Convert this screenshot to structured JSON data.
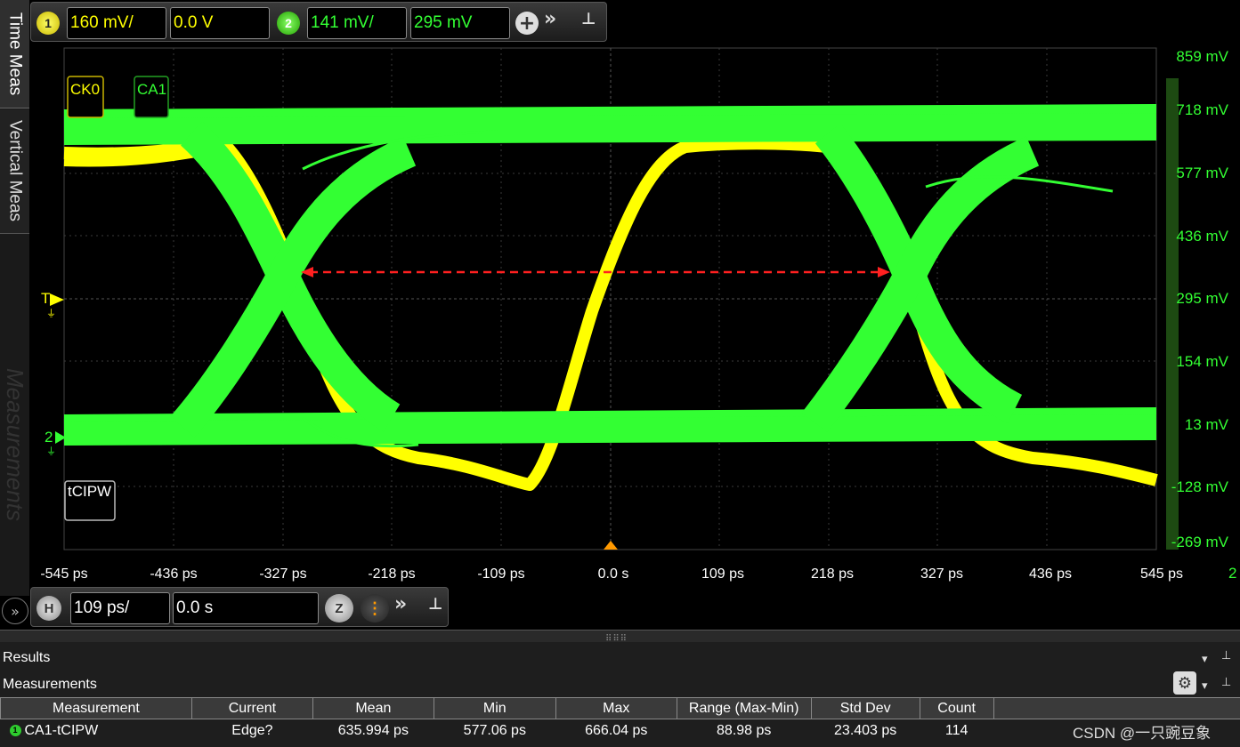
{
  "channels": {
    "ch1": {
      "number": "1",
      "scale": "160 mV/",
      "offset": "0.0 V",
      "color": "#ffff00"
    },
    "ch2": {
      "number": "2",
      "scale": "141 mV/",
      "offset": "295 mV",
      "color": "#33ff33"
    }
  },
  "side_tabs": [
    "Time Meas",
    "Vertical Meas",
    "Measurements"
  ],
  "plot": {
    "x_ticks": [
      "-545 ps",
      "-436 ps",
      "-327 ps",
      "-218 ps",
      "-109 ps",
      "0.0 s",
      "109 ps",
      "218 ps",
      "327 ps",
      "436 ps",
      "545 ps"
    ],
    "y_ticks": [
      "859 mV",
      "718 mV",
      "577 mV",
      "436 mV",
      "295 mV",
      "154 mV",
      "13 mV",
      "-128 mV",
      "-269 mV"
    ],
    "trace_labels": [
      "CK0",
      "CA1"
    ],
    "measurement_chip": "tCIPW",
    "marker_1": "T",
    "marker_2": "2",
    "right_edge_label": "2",
    "colors": {
      "ck0": "#ffff00",
      "ca1": "#33ff33",
      "cursor": "#ff2020",
      "grid": "#3a3a3a"
    }
  },
  "horizontal": {
    "badge": "H",
    "scale": "109 ps/",
    "position": "0.0 s",
    "zoom_label": "Z"
  },
  "results": {
    "title": "Results",
    "subtitle": "Measurements",
    "columns": [
      "Measurement",
      "Current",
      "Mean",
      "Min",
      "Max",
      "Range (Max-Min)",
      "Std Dev",
      "Count"
    ],
    "rows": [
      {
        "badge": "1",
        "name": "CA1-tCIPW",
        "current": "Edge?",
        "mean": "635.994 ps",
        "min": "577.06 ps",
        "max": "666.04 ps",
        "range": "88.98 ps",
        "std": "23.403 ps",
        "count": "114"
      }
    ]
  },
  "watermark": "CSDN @一只豌豆象"
}
